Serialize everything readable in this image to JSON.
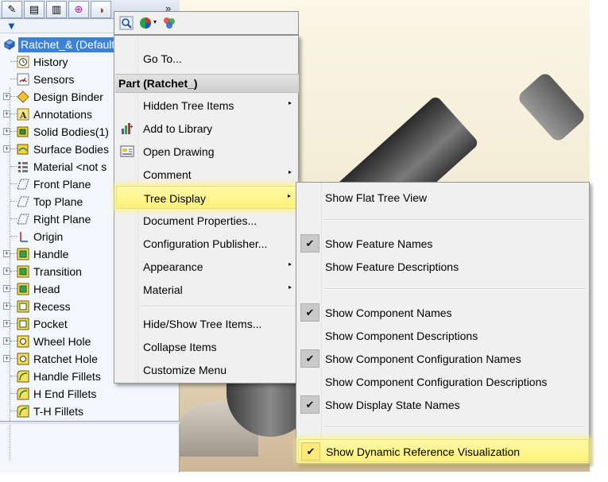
{
  "panel": {
    "tabs": [
      {
        "name": "feature-manager-tab-icon",
        "glyph": "✎"
      },
      {
        "name": "property-manager-tab-icon",
        "glyph": "▤"
      },
      {
        "name": "configuration-manager-tab-icon",
        "glyph": "▥"
      },
      {
        "name": "dimxpert-tab-icon",
        "glyph": "⊕"
      },
      {
        "name": "display-manager-tab-icon",
        "glyph": "◑"
      }
    ],
    "more": "»",
    "filter_glyph": "▼"
  },
  "tree": {
    "root_label": "Ratchet_&  (Default<<Default",
    "items": [
      {
        "label": "History",
        "toggle": "",
        "icon": "history-icon"
      },
      {
        "label": "Sensors",
        "toggle": "",
        "icon": "sensor-icon"
      },
      {
        "label": "Design Binder",
        "toggle": "+",
        "icon": "design-binder-icon"
      },
      {
        "label": "Annotations",
        "toggle": "+",
        "icon": "annotations-icon"
      },
      {
        "label": "Solid Bodies(1)",
        "toggle": "+",
        "icon": "solid-bodies-icon"
      },
      {
        "label": "Surface Bodies",
        "toggle": "+",
        "icon": "surface-bodies-icon"
      },
      {
        "label": "Material <not s",
        "toggle": "",
        "icon": "material-icon"
      },
      {
        "label": "Front Plane",
        "toggle": "",
        "icon": "plane-icon"
      },
      {
        "label": "Top Plane",
        "toggle": "",
        "icon": "plane-icon"
      },
      {
        "label": "Right Plane",
        "toggle": "",
        "icon": "plane-icon"
      },
      {
        "label": "Origin",
        "toggle": "",
        "icon": "origin-icon"
      },
      {
        "label": "Handle",
        "toggle": "+",
        "icon": "boss-extrude-icon"
      },
      {
        "label": "Transition",
        "toggle": "+",
        "icon": "boss-extrude-icon"
      },
      {
        "label": "Head",
        "toggle": "+",
        "icon": "boss-extrude-icon"
      },
      {
        "label": "Recess",
        "toggle": "+",
        "icon": "cut-extrude-icon"
      },
      {
        "label": "Pocket",
        "toggle": "+",
        "icon": "cut-extrude-icon"
      },
      {
        "label": "Wheel Hole",
        "toggle": "+",
        "icon": "hole-icon"
      },
      {
        "label": "Ratchet Hole",
        "toggle": "+",
        "icon": "hole-icon"
      },
      {
        "label": "Handle Fillets",
        "toggle": "",
        "icon": "fillet-icon"
      },
      {
        "label": "H End Fillets",
        "toggle": "",
        "icon": "fillet-icon"
      },
      {
        "label": "T-H Fillets",
        "toggle": "",
        "icon": "fillet-icon"
      }
    ]
  },
  "context_menu": {
    "goto": "Go To...",
    "header": "Part (Ratchet_)",
    "items": [
      {
        "label": "Hidden Tree Items",
        "submenu": true
      },
      {
        "label": "Add to Library",
        "submenu": false
      },
      {
        "label": "Open Drawing",
        "submenu": false
      },
      {
        "label": "Comment",
        "submenu": true
      },
      {
        "label": "Tree Display",
        "submenu": true,
        "highlight": true
      },
      {
        "label": "Document Properties...",
        "submenu": false
      },
      {
        "label": "Configuration Publisher...",
        "submenu": false
      },
      {
        "label": "Appearance",
        "submenu": true
      },
      {
        "label": "Material",
        "submenu": true
      }
    ],
    "bottom_items": [
      {
        "label": "Hide/Show Tree Items..."
      },
      {
        "label": "Collapse Items"
      },
      {
        "label": "Customize Menu"
      }
    ]
  },
  "submenu": {
    "items": [
      {
        "label": "Show Flat Tree View",
        "checked": false
      },
      {
        "label": "Show Feature Names",
        "checked": true
      },
      {
        "label": "Show Feature Descriptions",
        "checked": false
      },
      {
        "label": "Show Component Names",
        "checked": true
      },
      {
        "label": "Show Component Descriptions",
        "checked": false
      },
      {
        "label": "Show Component Configuration Names",
        "checked": true
      },
      {
        "label": "Show Component Configuration Descriptions",
        "checked": false
      },
      {
        "label": "Show Display State Names",
        "checked": true
      },
      {
        "label": "Show Dynamic Reference Visualization",
        "checked": true,
        "highlight": true
      }
    ],
    "check_glyph": "✔"
  },
  "arrow_glyph": "▸",
  "colors": {
    "selection": "#3d80d8",
    "highlight": "#fff17a",
    "menu_bg": "#f0f0f0"
  }
}
